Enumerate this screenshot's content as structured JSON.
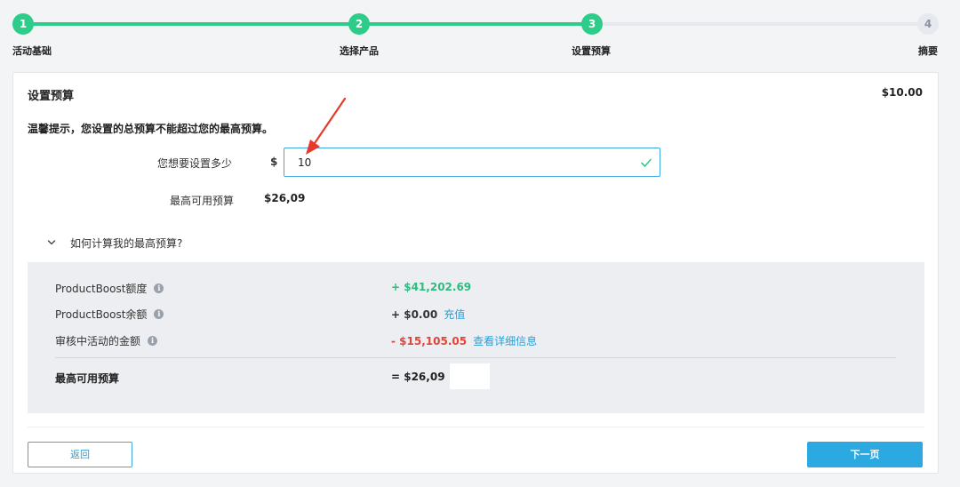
{
  "stepper": {
    "steps": [
      {
        "number": "1",
        "label": "活动基础",
        "state": "done"
      },
      {
        "number": "2",
        "label": "选择产品",
        "state": "done"
      },
      {
        "number": "3",
        "label": "设置预算",
        "state": "current"
      },
      {
        "number": "4",
        "label": "摘要",
        "state": "todo"
      }
    ]
  },
  "card": {
    "title": "设置预算",
    "amount": "$10.00",
    "tip": "温馨提示，您设置的总预算不能超过您的最高预算。",
    "budget_field": {
      "label": "您想要设置多少",
      "currency": "$",
      "value": "10"
    },
    "max_budget": {
      "label": "最高可用预算",
      "value": "$26,09"
    },
    "howto_toggle": "如何计算我的最高预算?",
    "calc": {
      "rows": [
        {
          "label": "ProductBoost额度",
          "value": "+ $41,202.69",
          "link": ""
        },
        {
          "label": "ProductBoost余额",
          "value": "+ $0.00",
          "link": "充值"
        },
        {
          "label": "审核中活动的金额",
          "value": "- $15,105.05",
          "link": "查看详细信息"
        }
      ],
      "total_label": "最高可用预算",
      "total_value": "= $26,09"
    },
    "back_button": "返回",
    "next_button": "下一页"
  },
  "colors": {
    "accent_green": "#2ecc8b",
    "accent_blue": "#2ca9e1",
    "negative_red": "#e0453a",
    "annotation_red": "#e53a2b"
  }
}
